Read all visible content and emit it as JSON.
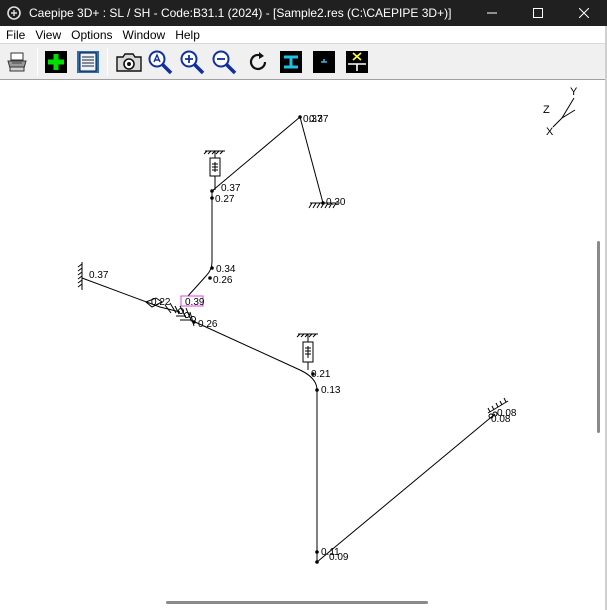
{
  "window": {
    "title": "Caepipe 3D+ : SL / SH - Code:B31.1 (2024) -  [Sample2.res (C:\\CAEPIPE 3D+)]"
  },
  "menu": [
    "File",
    "View",
    "Options",
    "Window",
    "Help"
  ],
  "toolbar": {
    "buttons": [
      "printer-icon",
      "add-icon",
      "list-icon",
      "camera-icon",
      "zoom-area-icon",
      "zoom-in-icon",
      "zoom-out-icon",
      "rotate-icon",
      "beam-icon",
      "support-icon",
      "crosshair-icon"
    ]
  },
  "axes": {
    "y": "Y",
    "z": "Z",
    "x": "X"
  },
  "model": {
    "labels": [
      "0.37",
      "0.37",
      "0.27",
      "0.30",
      "0.34",
      "0.26",
      "0.37",
      "0.22",
      "0.39",
      "0.26",
      "0.21",
      "0.13",
      "0.08",
      "0.08",
      "0.11",
      "0.09"
    ],
    "highlight_color": "#e040e0",
    "line_color": "#000000"
  }
}
